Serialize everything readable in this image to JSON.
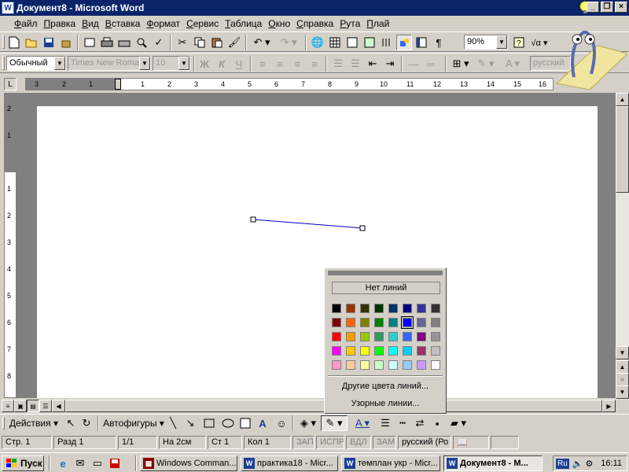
{
  "window": {
    "title": "Документ8 - Microsoft Word",
    "icon": "word-icon",
    "controls": [
      "_",
      "❐",
      "×"
    ]
  },
  "menu": [
    "Файл",
    "Правка",
    "Вид",
    "Вставка",
    "Формат",
    "Сервис",
    "Таблица",
    "Окно",
    "Справка",
    "Рута",
    "Плай"
  ],
  "toolbar_std": {
    "zoom": "90%",
    "icons": [
      "new-doc-icon",
      "open-icon",
      "save-icon",
      "permission-icon",
      "print-preview-icon",
      "print-icon",
      "spelling-icon",
      "cut-icon",
      "copy-icon",
      "paste-icon",
      "format-painter-icon",
      "undo-icon",
      "redo-icon",
      "hyperlink-icon",
      "tables-icon",
      "insert-table-icon",
      "insert-excel-icon",
      "columns-icon",
      "drawing-icon",
      "document-map-icon",
      "show-formatting-icon",
      "help-icon",
      "equation-icon"
    ]
  },
  "toolbar_fmt": {
    "style": "Обычный",
    "font": "Times New Roman",
    "size": "10",
    "language": "русский",
    "bold": "Ж",
    "italic": "К",
    "underline": "Ч"
  },
  "ruler": {
    "ticks": [
      "3",
      "2",
      "1",
      "1",
      "2",
      "3",
      "4",
      "5",
      "6",
      "7",
      "8",
      "9",
      "10",
      "11",
      "12",
      "13",
      "14",
      "15",
      "16"
    ],
    "vticks": [
      "2",
      "1",
      "1",
      "2",
      "3",
      "4",
      "5",
      "6",
      "7",
      "8"
    ]
  },
  "drawing": {
    "actions": "Действия",
    "autoshapes": "Автофигуры"
  },
  "line_color_popup": {
    "no_lines": "Нет линий",
    "colors": [
      [
        "#000000",
        "#993300",
        "#333300",
        "#003300",
        "#003366",
        "#000080",
        "#333399",
        "#333333"
      ],
      [
        "#800000",
        "#FF6600",
        "#808000",
        "#008000",
        "#008080",
        "#0000FF",
        "#666699",
        "#808080"
      ],
      [
        "#FF0000",
        "#FF9900",
        "#99CC00",
        "#339966",
        "#33CCCC",
        "#3366FF",
        "#800080",
        "#969696"
      ],
      [
        "#FF00FF",
        "#FFCC00",
        "#FFFF00",
        "#00FF00",
        "#00FFFF",
        "#00CCFF",
        "#993366",
        "#C0C0C0"
      ],
      [
        "#FF99CC",
        "#FFCC99",
        "#FFFF99",
        "#CCFFCC",
        "#CCFFFF",
        "#99CCFF",
        "#CC99FF",
        "#FFFFFF"
      ]
    ],
    "selected_color": "#0000FF",
    "more_colors": "Другие цвета линий...",
    "patterned_lines": "Узорные линии..."
  },
  "status": {
    "page": "Стр. 1",
    "section": "Разд 1",
    "pages": "1/1",
    "at": "На 2см",
    "line": "Ст 1",
    "col": "Кол 1",
    "rec": "ЗАП",
    "trk": "ИСПР",
    "ext": "ВДЛ",
    "ovr": "ЗАМ",
    "lang": "русский (Ро"
  },
  "taskbar": {
    "start": "Пуск",
    "tasks": [
      "Windows Comman...",
      "практика18 - Micr...",
      "темплан укр - Micr...",
      "Документ8 - М..."
    ],
    "lang": "Ru",
    "time": "16:11"
  },
  "colors": {
    "titlebar": "#0a246a",
    "face": "#d4d0c8",
    "line_shape": "#0000cc"
  }
}
